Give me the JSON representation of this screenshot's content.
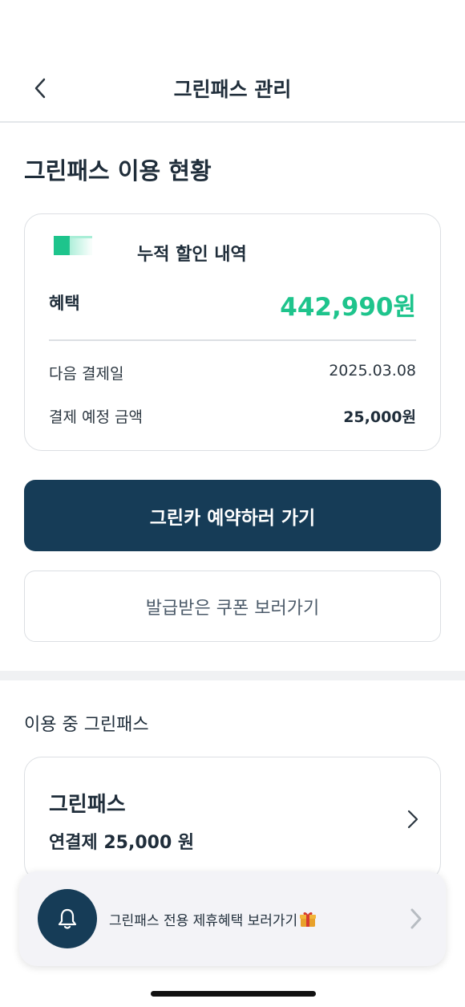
{
  "header": {
    "title": "그린패스 관리",
    "back_icon": "chevron-left-icon"
  },
  "usage": {
    "section_title": "그린패스 이용 현황",
    "card": {
      "heading": "누적 할인 내역",
      "benefit_label": "혜택",
      "benefit_value": "442,990원",
      "next_payment_label": "다음 결제일",
      "next_payment_value": "2025.03.08",
      "expected_amount_label": "결제 예정 금액",
      "expected_amount_value": "25,000원"
    }
  },
  "actions": {
    "reserve_label": "그린카 예약하러 가기",
    "coupons_label": "발급받은 쿠폰 보러가기"
  },
  "in_use": {
    "section_title": "이용 중 그린패스",
    "pass_name": "그린패스",
    "pass_price": "연결제 25,000 원"
  },
  "toast": {
    "text": "그린패스 전용 제휴혜택 보러가기",
    "icon": "bell-icon",
    "emoji_icon": "gift-icon"
  },
  "colors": {
    "accent_green": "#1ec48c",
    "navy": "#163c57",
    "text": "#1f2d3a",
    "border": "#dcdfe3"
  }
}
